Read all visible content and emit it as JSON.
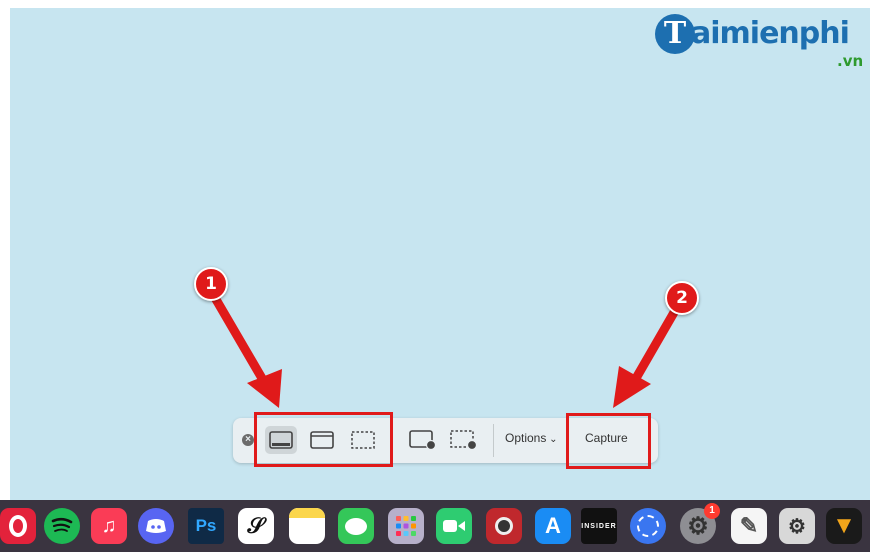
{
  "watermark": {
    "initial": "T",
    "text": "aimienphi",
    "suffix": ".vn"
  },
  "toolbar": {
    "close_icon": "close-icon",
    "capture_modes": [
      "capture-entire-screen-icon",
      "capture-selected-window-icon",
      "capture-selected-portion-icon"
    ],
    "record_modes": [
      "record-entire-screen-icon",
      "record-selected-portion-icon"
    ],
    "options_label": "Options",
    "capture_label": "Capture"
  },
  "annotations": {
    "badge1": "1",
    "badge2": "2",
    "color": "#e01a1a"
  },
  "dock": {
    "apps": [
      {
        "name": "opera",
        "icon": "opera-icon",
        "color": "#e3223b"
      },
      {
        "name": "spotify",
        "icon": "spotify-icon",
        "color": "#1db954"
      },
      {
        "name": "music",
        "icon": "music-icon",
        "color": "#fa3c56"
      },
      {
        "name": "discord",
        "icon": "discord-icon",
        "color": "#5865f2"
      },
      {
        "name": "photoshop",
        "icon": "photoshop-icon",
        "color": "#0f2a46",
        "label": "Ps"
      },
      {
        "name": "inkdrop",
        "icon": "ink-icon",
        "color": "#ffffff"
      },
      {
        "name": "notes",
        "icon": "notes-icon",
        "color": "#fbd64c"
      },
      {
        "name": "messages",
        "icon": "messages-icon",
        "color": "#34c759"
      },
      {
        "name": "launchpad",
        "icon": "launchpad-icon",
        "color": "#b7b0ca"
      },
      {
        "name": "facetime",
        "icon": "facetime-icon",
        "color": "#2ecc71"
      },
      {
        "name": "photo-booth",
        "icon": "photo-booth-icon",
        "color": "#c0282d"
      },
      {
        "name": "app-store",
        "icon": "app-store-icon",
        "color": "#1a8cf4"
      },
      {
        "name": "insider",
        "icon": "insider-icon",
        "color": "#111111",
        "label": "INSIDER"
      },
      {
        "name": "signal",
        "icon": "signal-icon",
        "color": "#3a76f0"
      },
      {
        "name": "system-preferences",
        "icon": "gear-icon",
        "color": "#8e8e93",
        "badge": "1"
      },
      {
        "name": "textedit",
        "icon": "textedit-icon",
        "color": "#f5f5f5"
      },
      {
        "name": "automator",
        "icon": "automator-icon",
        "color": "#d8d8d8"
      },
      {
        "name": "vectorize",
        "icon": "vector-icon",
        "color": "#1a1a1a"
      }
    ]
  }
}
